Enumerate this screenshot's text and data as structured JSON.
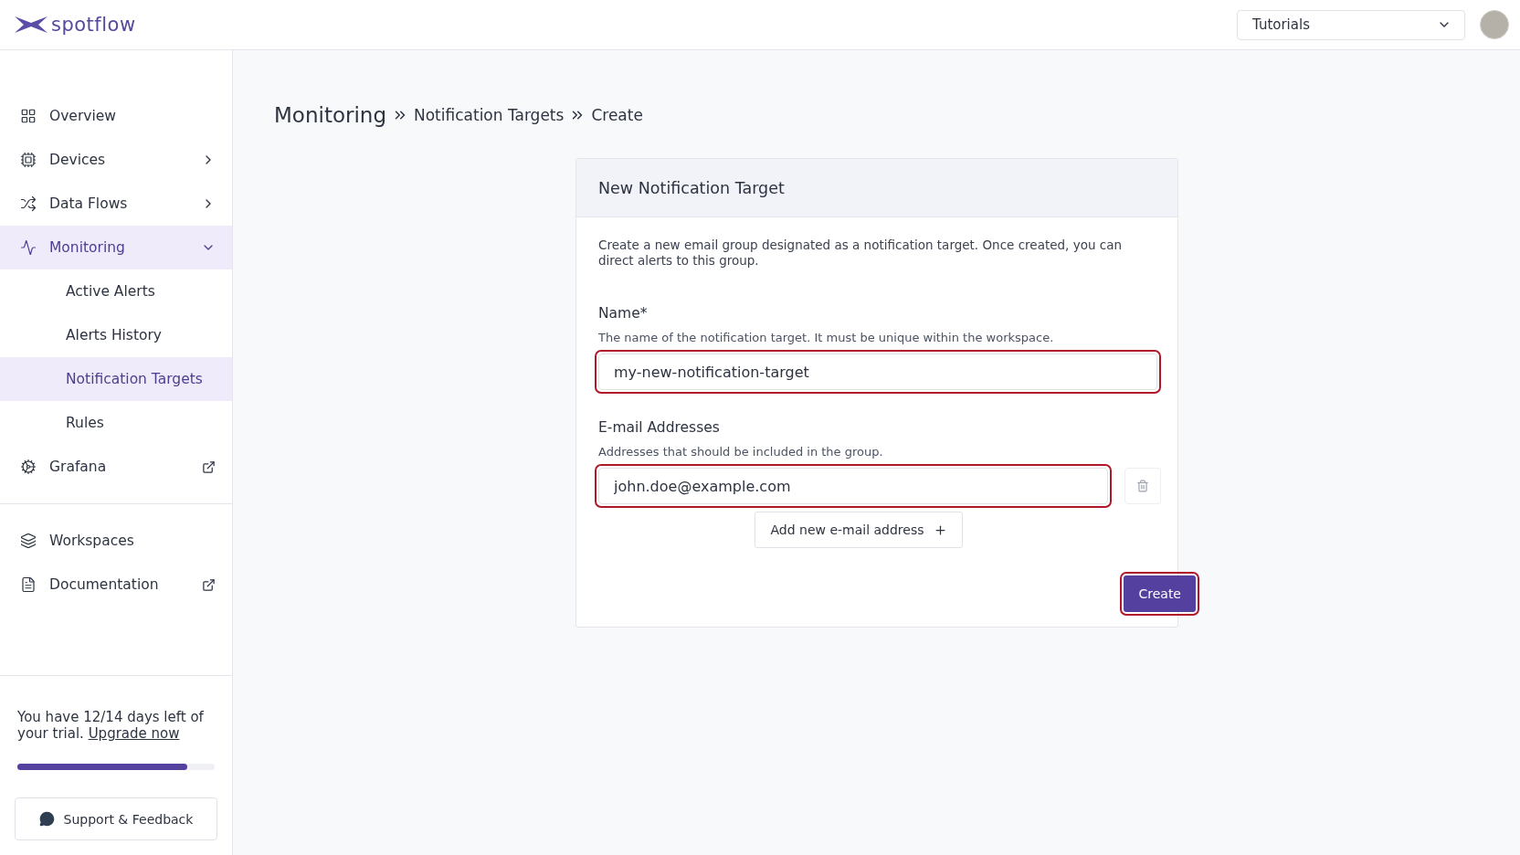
{
  "header": {
    "logo_text": "spotflow",
    "workspace_select": {
      "value": "Tutorials"
    }
  },
  "sidebar": {
    "items": [
      {
        "label": "Overview",
        "kind": "plain",
        "selected": false
      },
      {
        "label": "Devices",
        "kind": "expandable",
        "expanded": false,
        "selected": false
      },
      {
        "label": "Data Flows",
        "kind": "expandable",
        "expanded": false,
        "selected": false
      },
      {
        "label": "Monitoring",
        "kind": "expandable",
        "selected": true,
        "expanded": true,
        "children": [
          {
            "label": "Active Alerts",
            "selected": false
          },
          {
            "label": "Alerts History",
            "selected": false
          },
          {
            "label": "Notification Targets",
            "selected": true
          },
          {
            "label": "Rules",
            "selected": false
          }
        ]
      },
      {
        "label": "Grafana",
        "kind": "external",
        "selected": false
      }
    ],
    "secondary_items": [
      {
        "label": "Workspaces",
        "kind": "plain",
        "selected": false
      },
      {
        "label": "Documentation",
        "kind": "external",
        "selected": false
      }
    ],
    "trial": {
      "text": "You have 12/14 days left of your trial.",
      "link": "Upgrade now",
      "level": 0.86
    },
    "support_button": "Support & Feedback"
  },
  "breadcrumb": [
    {
      "label": "Monitoring",
      "kind": "root"
    },
    {
      "label": "Notification Targets",
      "kind": "crumb"
    },
    {
      "label": "Create",
      "kind": "crumb"
    }
  ],
  "card": {
    "title": "New Notification Target",
    "description": "Create a new email group designated as a notification target. Once created, you can direct alerts to this group.",
    "name_field": {
      "label": "Name*",
      "hint": "The name of the notification target. It must be unique within the workspace.",
      "value": "my-new-notification-target",
      "highlighted": true
    },
    "emails": {
      "label": "E-mail Addresses",
      "hint": "Addresses that should be included in the group.",
      "entries": [
        {
          "value": "john.doe@example.com",
          "highlighted": true
        }
      ],
      "add_button": "Add new e-mail address"
    },
    "create_button": {
      "label": "Create",
      "highlighted": true
    }
  }
}
